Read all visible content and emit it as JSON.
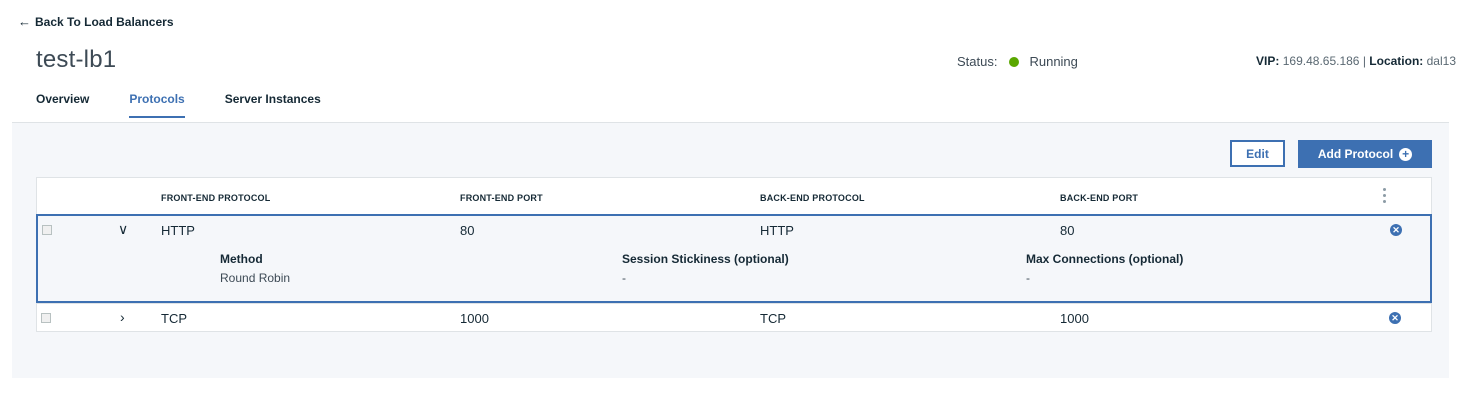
{
  "nav": {
    "back_label": "Back To Load Balancers",
    "back_icon": "arrow-left-icon"
  },
  "page": {
    "title": "test-lb1",
    "status_label": "Status:",
    "status_value": "Running",
    "status_color": "#5aa700",
    "vip_label": "VIP:",
    "vip_value": "169.48.65.186",
    "separator": " | ",
    "location_label": "Location:",
    "location_value": "dal13"
  },
  "tabs": [
    {
      "label": "Overview",
      "active": false
    },
    {
      "label": "Protocols",
      "active": true
    },
    {
      "label": "Server Instances",
      "active": false
    }
  ],
  "toolbar": {
    "edit_label": "Edit",
    "add_label": "Add Protocol"
  },
  "table": {
    "headers": [
      "FRONT-END PROTOCOL",
      "FRONT-END PORT",
      "BACK-END PROTOCOL",
      "BACK-END PORT"
    ],
    "rows": [
      {
        "front_protocol": "HTTP",
        "front_port": "80",
        "back_protocol": "HTTP",
        "back_port": "80",
        "expanded": true
      },
      {
        "front_protocol": "TCP",
        "front_port": "1000",
        "back_protocol": "TCP",
        "back_port": "1000",
        "expanded": false
      }
    ],
    "details": {
      "method_label": "Method",
      "method_value": "Round Robin",
      "stickiness_label": "Session Stickiness (optional)",
      "stickiness_value": "-",
      "max_conn_label": "Max Connections (optional)",
      "max_conn_value": "-"
    }
  },
  "colors": {
    "accent": "#3d70b2",
    "running": "#5aa700",
    "panel_bg": "#f5f7fa"
  }
}
